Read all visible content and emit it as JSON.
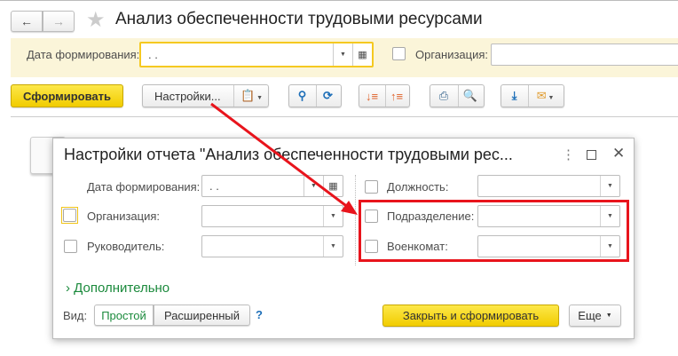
{
  "window": {
    "title": "Анализ обеспеченности трудовыми ресурсами"
  },
  "filters": {
    "date_label": "Дата формирования:",
    "date_value": " .  .",
    "org_label": "Организация:"
  },
  "toolbar": {
    "generate": "Сформировать",
    "settings": "Настройки..."
  },
  "dialog": {
    "title": "Настройки отчета \"Анализ обеспеченности трудовыми рес...",
    "date_label": "Дата формирования:",
    "date_value": " .  .",
    "org_label": "Организация:",
    "manager_label": "Руководитель:",
    "position_label": "Должность:",
    "department_label": "Подразделение:",
    "military_label": "Военкомат:",
    "more_section": "Дополнительно",
    "view_label": "Вид:",
    "view_simple": "Простой",
    "view_extended": "Расширенный",
    "help": "?",
    "close_generate": "Закрыть и сформировать",
    "more": "Еще"
  },
  "colors": {
    "accent": "#f5d400",
    "annotation": "#e8141c",
    "link_green": "#1b8a3c"
  }
}
